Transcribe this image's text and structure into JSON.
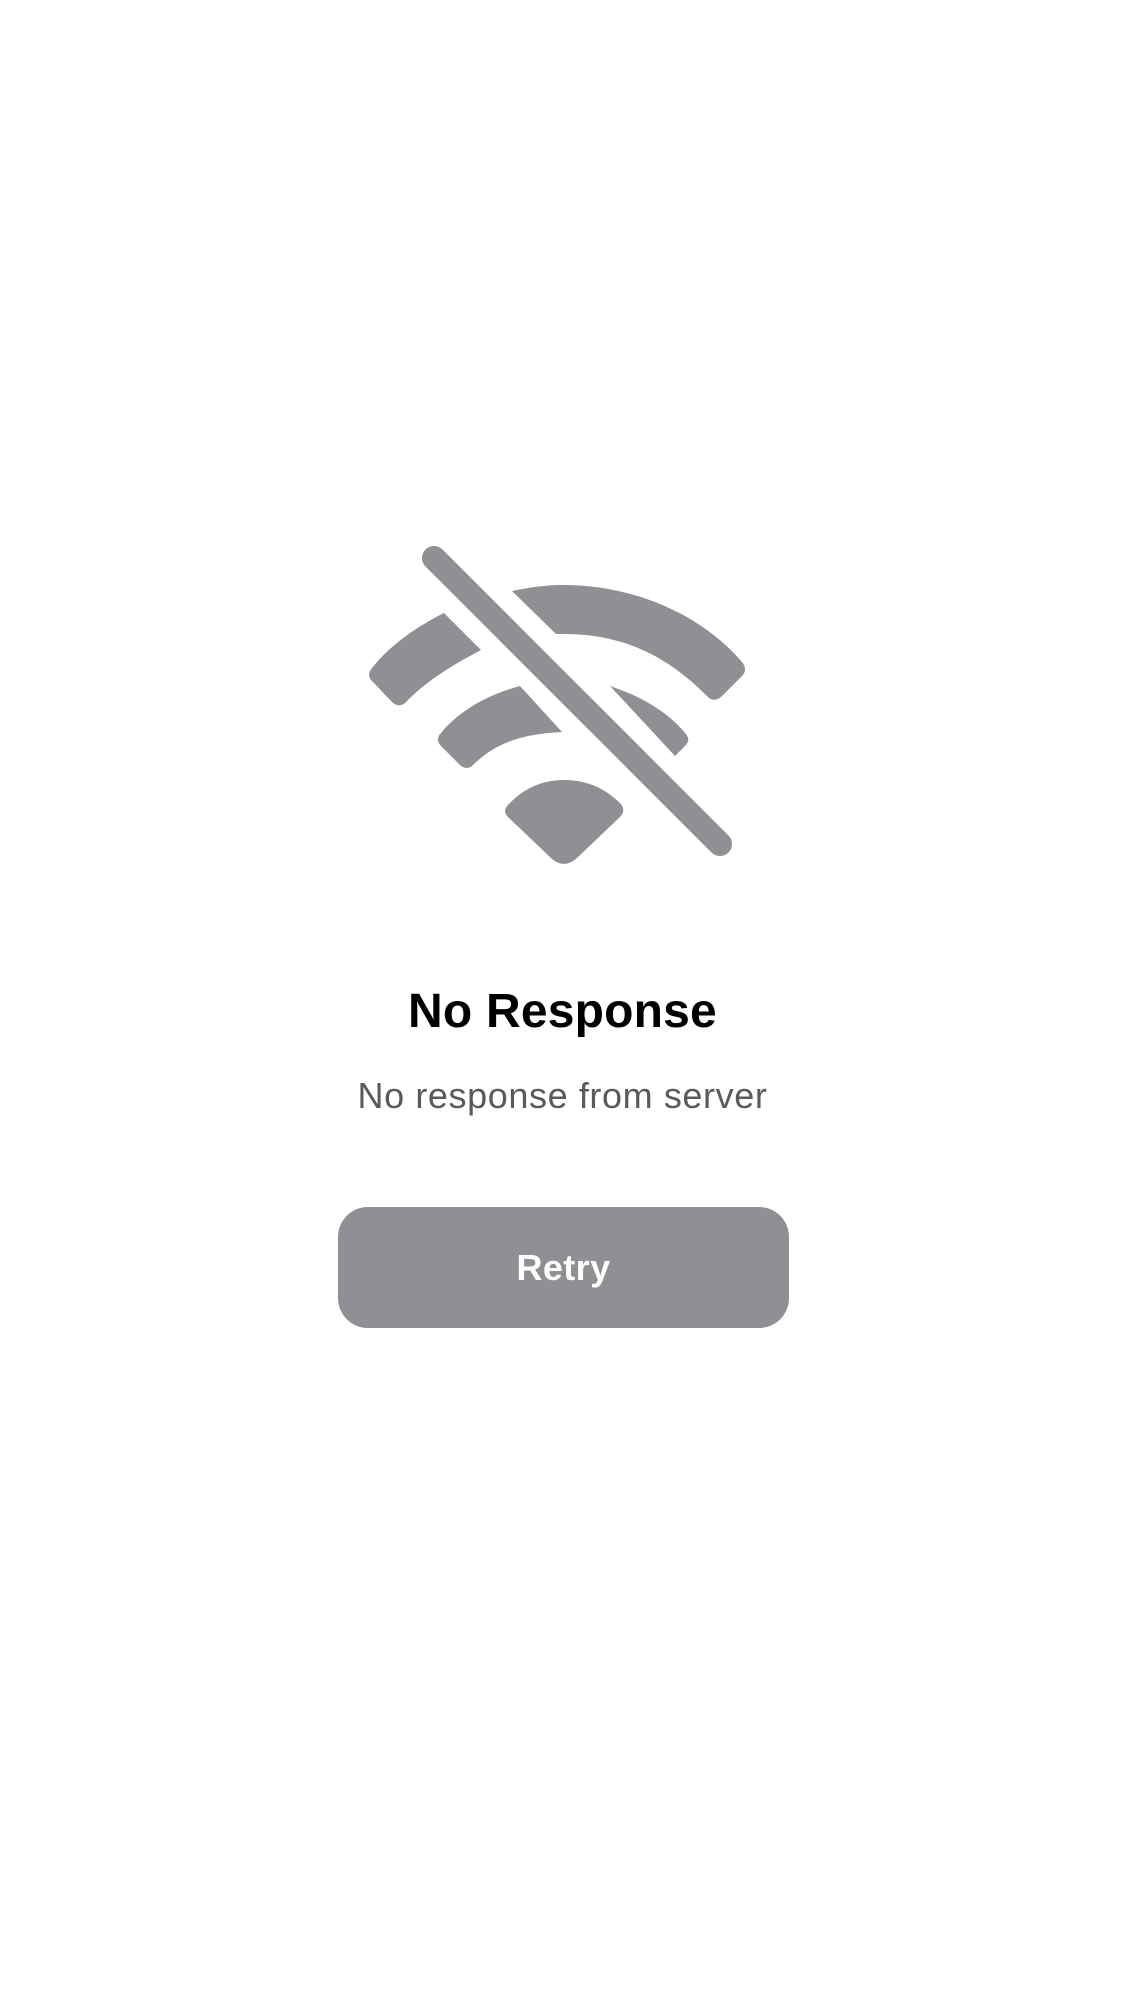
{
  "colors": {
    "background": "#ffffff",
    "icon": "#8f8f94",
    "title": "#000000",
    "subtitle": "#5a5a5e",
    "button_background": "#8f8f94",
    "button_text": "#ffffff"
  },
  "status_icon": {
    "name": "wifi-slash-icon"
  },
  "message": {
    "title": "No Response",
    "subtitle": "No response from server"
  },
  "actions": {
    "retry_label": "Retry"
  }
}
